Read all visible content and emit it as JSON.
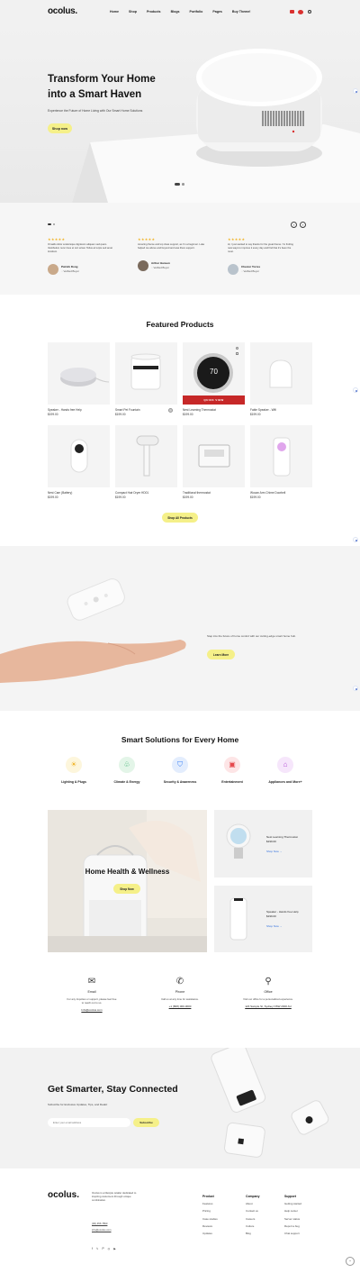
{
  "header": {
    "logo": "ocolus.",
    "nav": [
      "Home",
      "Shop",
      "Products",
      "Blogs",
      "Portfolio",
      "Pages",
      "Buy Theme!"
    ]
  },
  "hero": {
    "title_line1": "Transform Your Home",
    "title_line2": "into a Smart Haven",
    "subtitle": "Experience the Future of Home Living with Our Smart Home Solutions",
    "button": "Shop now"
  },
  "testimonials": [
    {
      "stars": "★★★★★",
      "text_line1": "Ornaldo dolor scelerisque dignissim aliquam sed quam.",
      "text_line2": "Vestibulum nunc risus et orci erisat. Tellus at turpis sed amet",
      "text_line3": "tincidunt.",
      "name": "Patrick Dong",
      "role": "Verified Buyer"
    },
    {
      "stars": "★★★★★",
      "text_line1": "Amazing theme and top class support, as I'm a beginner. Luke",
      "text_line2": "helped me above and beyond and was there support.",
      "text_line3": "",
      "name": "Arthur Hansen",
      "role": "Verified Buyer"
    },
    {
      "stars": "★★★★★",
      "text_line1": "Hi, I just wanted to say thanks for the great theme. I'm finding",
      "text_line2": "new ways to improve it every day and find that it's been the",
      "text_line3": "most.",
      "name": "Chester Torres",
      "role": "Verified Buyer"
    }
  ],
  "featured": {
    "title": "Featured Products",
    "quick_view": "QUICK VIEW",
    "button": "Shop All Products",
    "products": [
      {
        "name": "Speaker - Hands free Help",
        "price": "$199.00"
      },
      {
        "name": "Smart Pet Fountain",
        "price": "$199.00"
      },
      {
        "name": "Nest Learning Thermostat",
        "price": "$199.00"
      },
      {
        "name": "Fable Speaker - Wifi",
        "price": "$199.00"
      },
      {
        "name": "Nest Cam (Battery)",
        "price": "$199.00"
      },
      {
        "name": "Compact Hair Dryer HD01",
        "price": "$199.00"
      },
      {
        "name": "Traditional thermostat",
        "price": "$199.00"
      },
      {
        "name": "Wocan Arm Chime Doorbell",
        "price": "$199.00"
      }
    ],
    "thermostat_reading": "70"
  },
  "promo": {
    "text": "Step into the future of home control with our cutting-edge smart home hub.",
    "button": "Learn More"
  },
  "solutions": {
    "title": "Smart Solutions for Every Home",
    "items": [
      {
        "label": "Lighting & Plugs",
        "icon": "bulb-icon",
        "color": "#f0b429"
      },
      {
        "label": "Climate & Energy",
        "icon": "leaf-plug-icon",
        "color": "#3cb371"
      },
      {
        "label": "Security & Awareness",
        "icon": "shield-icon",
        "color": "#3b82f6"
      },
      {
        "label": "Entertainment",
        "icon": "tv-icon",
        "color": "#e5484d"
      },
      {
        "label": "Appliances and More+",
        "icon": "house-icon",
        "color": "#b44fd6"
      }
    ]
  },
  "banners": {
    "big_title": "Home Health & Wellness",
    "big_button": "Shop Now",
    "small1_name": "Nest Learning Thermostat",
    "small1_price": "$199.00",
    "small1_link": "Shop Now →",
    "small2_name": "Speaker - Hands free Help",
    "small2_price": "$199.00",
    "small2_link": "Shop Now →"
  },
  "contact": [
    {
      "title": "Email",
      "line1": "For any Inquiries or support, please feel free",
      "line2": "to reach out to us.",
      "value": "Info@ocolus.com",
      "icon": "envelope-icon"
    },
    {
      "title": "Phone",
      "line1": "Call us at any time for assistance.",
      "line2": "",
      "value": "+1 (808) 000-0000",
      "icon": "phone-icon"
    },
    {
      "title": "Office",
      "line1": "Visit our office for a personalized experience.",
      "line2": "",
      "value": "123 Sample St, Sydney NSW 2000 AU",
      "icon": "map-user-icon"
    }
  ],
  "newsletter": {
    "title": "Get Smarter, Stay Connected",
    "subtitle": "Subscribe for Exclusive Updates, Tips, and Deals!",
    "placeholder": "Enter your email address",
    "button": "Subscribe"
  },
  "footer": {
    "logo": "ocolus.",
    "desc_line1": "Ocolus is a lifestyle retailer dedicated to",
    "desc_line2": "inspiring customers through unique",
    "desc_line3": "combination.",
    "phone": "(00) 456 7890",
    "email": "info@ocolus.com",
    "columns": [
      {
        "title": "Product",
        "links": [
          "Features",
          "Pricing",
          "Case studies",
          "Reviews",
          "Updates"
        ]
      },
      {
        "title": "Company",
        "links": [
          "About",
          "Contact us",
          "Careers",
          "Culture",
          "Blog"
        ]
      },
      {
        "title": "Support",
        "links": [
          "Getting started",
          "Help center",
          "Server status",
          "Report a bug",
          "Chat support"
        ]
      }
    ],
    "social": [
      "f",
      "𝕏",
      "P",
      "◎",
      "▶"
    ]
  },
  "colors": {
    "accent": "#f5f089",
    "quick_view": "#c62828",
    "link": "#2f6fde"
  }
}
